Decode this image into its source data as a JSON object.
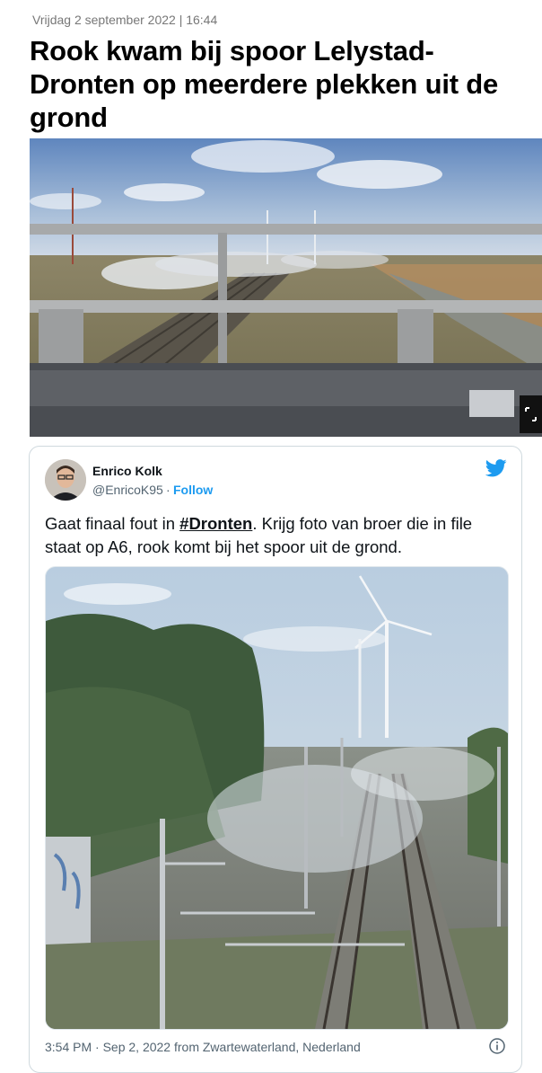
{
  "article": {
    "date": "Vrijdag 2 september 2022 | 16:44",
    "headline": "Rook kwam bij spoor Lelystad-Dronten op meerdere plekken uit de grond"
  },
  "hero_image": {
    "icon": "expand-icon"
  },
  "tweet": {
    "author_name": "Enrico Kolk",
    "author_handle": "@EnricoK95",
    "separator": "·",
    "follow_label": "Follow",
    "text_before": "Gaat finaal fout in ",
    "hashtag": "#Dronten",
    "text_after": ". Krijg foto van broer die in file staat op A6, rook komt bij het spoor uit de grond.",
    "meta": "3:54 PM · Sep 2, 2022 from Zwartewaterland, Nederland",
    "brand_icon": "twitter-bird-icon",
    "info_icon": "info-icon",
    "accent_color": "#1d9bf0"
  }
}
